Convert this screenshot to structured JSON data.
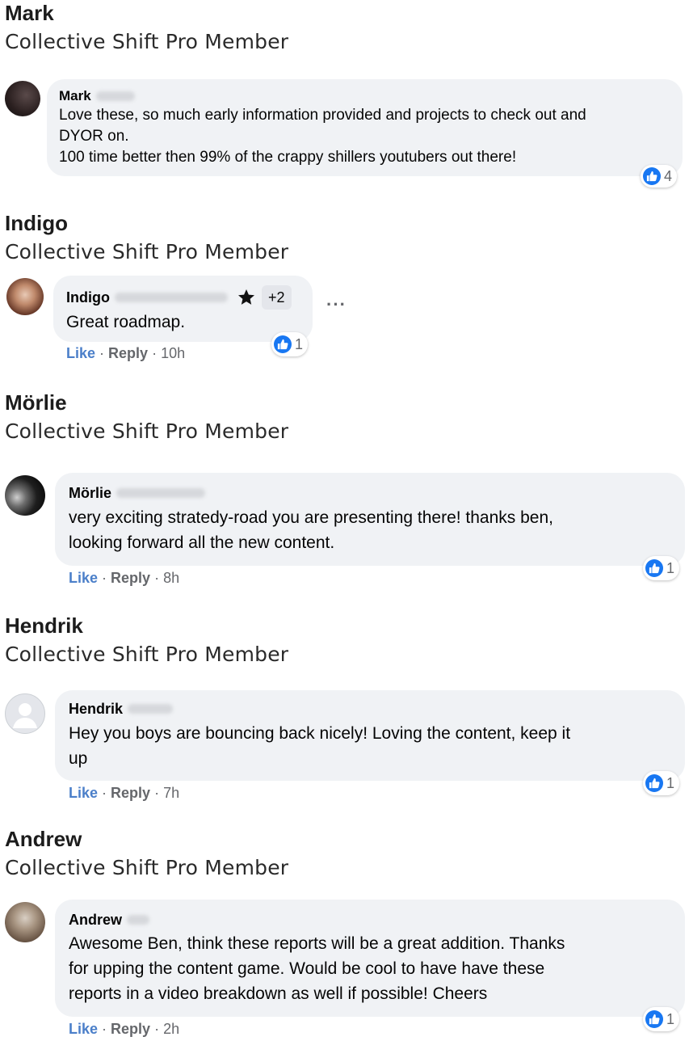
{
  "comments": [
    {
      "heading_name": "Mark",
      "heading_role": "Collective Shift Pro Member",
      "author": "Mark",
      "lines": [
        "Love these, so much early information provided and projects to check out and",
        "DYOR on.",
        "100 time better then 99% of the crappy shillers youtubers out there!"
      ],
      "reactions": "4"
    },
    {
      "heading_name": "Indigo",
      "heading_role": "Collective Shift Pro Member",
      "author": "Indigo",
      "badge_extra": "+2",
      "lines": [
        "Great roadmap."
      ],
      "reactions": "1",
      "like": "Like",
      "reply": "Reply",
      "time": "10h"
    },
    {
      "heading_name": "Mörlie",
      "heading_role": "Collective Shift Pro Member",
      "author": "Mörlie",
      "lines": [
        "very exciting stratedy-road you are presenting there! thanks ben,",
        "looking forward all the new content."
      ],
      "reactions": "1",
      "like": "Like",
      "reply": "Reply",
      "time": "8h"
    },
    {
      "heading_name": "Hendrik",
      "heading_role": "Collective Shift Pro Member",
      "author": "Hendrik",
      "lines": [
        "Hey you boys are bouncing back nicely! Loving the content, keep it",
        "up"
      ],
      "reactions": "1",
      "like": "Like",
      "reply": "Reply",
      "time": "7h"
    },
    {
      "heading_name": "Andrew",
      "heading_role": "Collective Shift Pro Member",
      "author": "Andrew",
      "lines": [
        "Awesome Ben, think these reports will be a great addition. Thanks",
        "for upping the content game. Would be cool to have have these",
        "reports in a video breakdown as well if possible! Cheers"
      ],
      "reactions": "1",
      "like": "Like",
      "reply": "Reply",
      "time": "2h"
    }
  ],
  "colors": {
    "bubble": "#f0f2f5",
    "like_blue": "#1877f2",
    "meta_gray": "#65676b"
  },
  "icons": [
    "thumbs-up-icon",
    "star-icon",
    "more-icon",
    "avatar-placeholder-icon"
  ]
}
